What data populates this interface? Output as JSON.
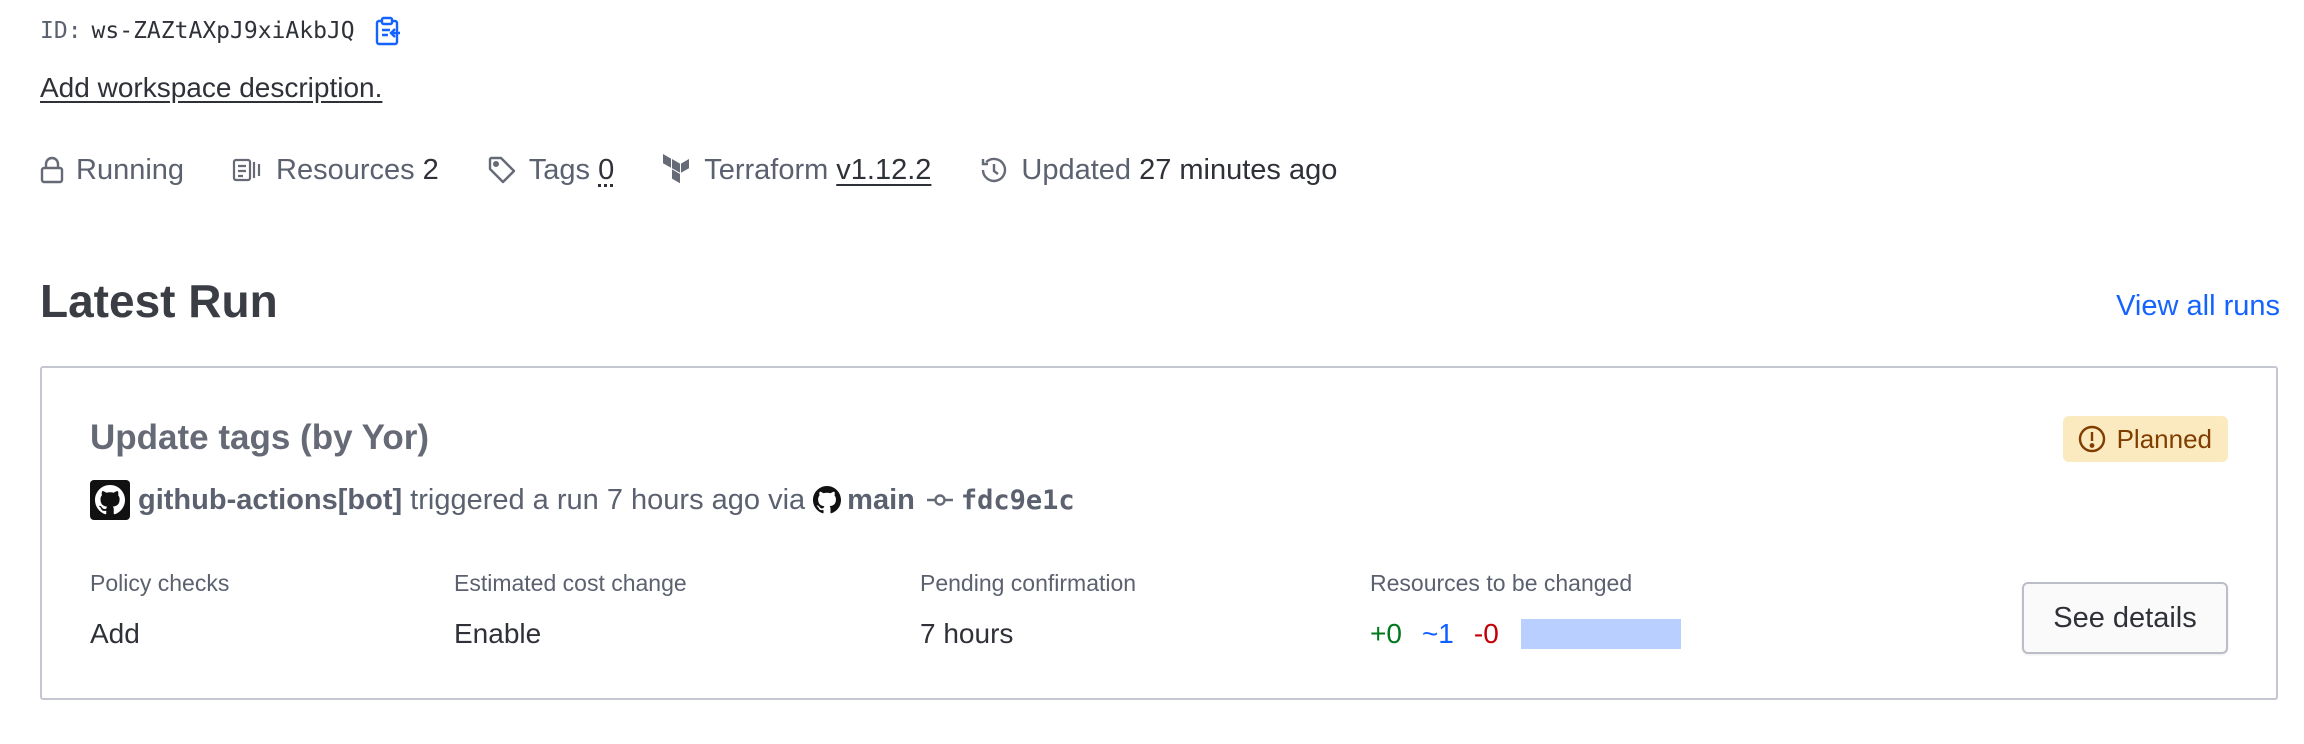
{
  "workspace": {
    "id_label": "ID:",
    "id_value": "ws-ZAZtAXpJ9xiAkbJQ",
    "description_link": "Add workspace description."
  },
  "meta": {
    "lock_status": "Running",
    "resources_label": "Resources",
    "resources_count": "2",
    "tags_label": "Tags",
    "tags_count": "0",
    "terraform_label": "Terraform",
    "terraform_version": "v1.12.2",
    "updated_label": "Updated",
    "updated_value": "27 minutes ago"
  },
  "latest_run": {
    "section_title": "Latest Run",
    "view_all_link": "View all runs",
    "title": "Update tags (by Yor)",
    "status": "Planned",
    "actor": "github-actions[bot]",
    "trigger_text": "triggered a run 7 hours ago via",
    "branch": "main",
    "commit": "fdc9e1c",
    "columns": {
      "policy_label": "Policy checks",
      "policy_value": "Add",
      "cost_label": "Estimated cost change",
      "cost_value": "Enable",
      "pending_label": "Pending confirmation",
      "pending_value": "7 hours",
      "resources_label": "Resources to be changed",
      "add_count": "+0",
      "change_count": "~1",
      "destroy_count": "-0"
    },
    "see_details": "See details"
  },
  "colors": {
    "link": "#1563ff",
    "badge_bg": "#fbeabf",
    "badge_text": "#803d00",
    "add": "#00781e",
    "change": "#1060ff",
    "destroy": "#c00005",
    "change_bar": "#b8cfff"
  },
  "icons": {
    "copy": "clipboard-icon",
    "lock": "lock-icon",
    "resources": "resources-icon",
    "tags": "tag-icon",
    "terraform": "terraform-icon",
    "updated": "history-icon",
    "status": "alert-circle-icon",
    "avatar": "github-icon",
    "branch": "github-icon",
    "commit": "git-commit-icon"
  }
}
